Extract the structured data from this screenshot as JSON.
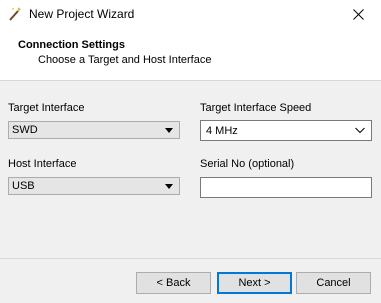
{
  "window": {
    "title": "New Project Wizard",
    "title_icon": "wand-icon",
    "close_icon": "close-icon"
  },
  "header": {
    "title": "Connection Settings",
    "subtitle": "Choose a Target and Host Interface"
  },
  "form": {
    "target_interface": {
      "label": "Target Interface",
      "value": "SWD"
    },
    "target_speed": {
      "label": "Target Interface Speed",
      "value": "4 MHz"
    },
    "host_interface": {
      "label": "Host Interface",
      "value": "USB"
    },
    "serial_no": {
      "label": "Serial No (optional)",
      "value": ""
    }
  },
  "buttons": {
    "back": "< Back",
    "next": "Next >",
    "cancel": "Cancel"
  },
  "colors": {
    "default_button_border": "#0078d7",
    "dialog_bg": "#f0f0f0"
  }
}
